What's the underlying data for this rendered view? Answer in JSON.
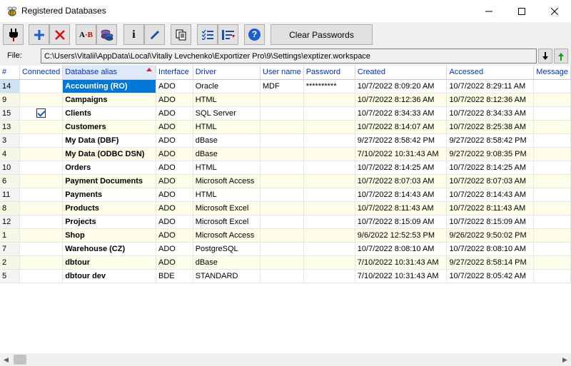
{
  "window": {
    "title": "Registered Databases",
    "minimize_glyph": "—",
    "maximize_glyph": "☐",
    "close_glyph": "✕"
  },
  "toolbar": {
    "buttons": [
      {
        "name": "connect-plug-icon"
      },
      {
        "name": "add-icon"
      },
      {
        "name": "delete-icon"
      },
      {
        "name": "rename-ab-icon",
        "text": "A·B"
      },
      {
        "name": "database-stack-icon"
      },
      {
        "name": "info-icon",
        "text": "i"
      },
      {
        "name": "edit-pen-icon"
      },
      {
        "name": "copy-icon"
      },
      {
        "name": "checklist-icon"
      },
      {
        "name": "sort-list-icon"
      },
      {
        "name": "help-icon",
        "text": "?"
      }
    ],
    "clear_passwords_label": "Clear Passwords"
  },
  "file": {
    "label": "File:",
    "path": "C:\\Users\\Vitalii\\AppData\\Local\\Vitaliy Levchenko\\Exportizer Pro\\9\\Settings\\exptizer.workspace"
  },
  "grid": {
    "columns": [
      "#",
      "Connected",
      "Database alias",
      "Interface",
      "Driver",
      "User name",
      "Password",
      "Created",
      "Accessed",
      "Message"
    ],
    "sorted_column": "Database alias",
    "rows": [
      {
        "num": "14",
        "connected": false,
        "alias": "Accounting (RO)",
        "interface": "ADO",
        "driver": "Oracle",
        "user": "MDF",
        "password": "**********",
        "created": "10/7/2022 8:09:20 AM",
        "accessed": "10/7/2022 8:29:11 AM",
        "selected": true
      },
      {
        "num": "9",
        "connected": false,
        "alias": "Campaigns",
        "interface": "ADO",
        "driver": "HTML",
        "user": "",
        "password": "",
        "created": "10/7/2022 8:12:36 AM",
        "accessed": "10/7/2022 8:12:36 AM"
      },
      {
        "num": "15",
        "connected": true,
        "alias": "Clients",
        "interface": "ADO",
        "driver": "SQL Server",
        "user": "",
        "password": "",
        "created": "10/7/2022 8:34:33 AM",
        "accessed": "10/7/2022 8:34:33 AM"
      },
      {
        "num": "13",
        "connected": false,
        "alias": "Customers",
        "interface": "ADO",
        "driver": "HTML",
        "user": "",
        "password": "",
        "created": "10/7/2022 8:14:07 AM",
        "accessed": "10/7/2022 8:25:38 AM"
      },
      {
        "num": "3",
        "connected": false,
        "alias": "My Data (DBF)",
        "interface": "ADO",
        "driver": "dBase",
        "user": "",
        "password": "",
        "created": "9/27/2022 8:58:42 PM",
        "accessed": "9/27/2022 8:58:42 PM"
      },
      {
        "num": "4",
        "connected": false,
        "alias": "My Data (ODBC DSN)",
        "interface": "ADO",
        "driver": "dBase",
        "user": "",
        "password": "",
        "created": "7/10/2022 10:31:43 AM",
        "accessed": "9/27/2022 9:08:35 PM"
      },
      {
        "num": "10",
        "connected": false,
        "alias": "Orders",
        "interface": "ADO",
        "driver": "HTML",
        "user": "",
        "password": "",
        "created": "10/7/2022 8:14:25 AM",
        "accessed": "10/7/2022 8:14:25 AM"
      },
      {
        "num": "6",
        "connected": false,
        "alias": "Payment Documents",
        "interface": "ADO",
        "driver": "Microsoft Access",
        "user": "",
        "password": "",
        "created": "10/7/2022 8:07:03 AM",
        "accessed": "10/7/2022 8:07:03 AM"
      },
      {
        "num": "11",
        "connected": false,
        "alias": "Payments",
        "interface": "ADO",
        "driver": "HTML",
        "user": "",
        "password": "",
        "created": "10/7/2022 8:14:43 AM",
        "accessed": "10/7/2022 8:14:43 AM"
      },
      {
        "num": "8",
        "connected": false,
        "alias": "Products",
        "interface": "ADO",
        "driver": "Microsoft Excel",
        "user": "",
        "password": "",
        "created": "10/7/2022 8:11:43 AM",
        "accessed": "10/7/2022 8:11:43 AM"
      },
      {
        "num": "12",
        "connected": false,
        "alias": "Projects",
        "interface": "ADO",
        "driver": "Microsoft Excel",
        "user": "",
        "password": "",
        "created": "10/7/2022 8:15:09 AM",
        "accessed": "10/7/2022 8:15:09 AM"
      },
      {
        "num": "1",
        "connected": false,
        "alias": "Shop",
        "interface": "ADO",
        "driver": "Microsoft Access",
        "user": "",
        "password": "",
        "created": "9/6/2022 12:52:53 PM",
        "accessed": "9/26/2022 9:50:02 PM"
      },
      {
        "num": "7",
        "connected": false,
        "alias": "Warehouse (CZ)",
        "interface": "ADO",
        "driver": "PostgreSQL",
        "user": "",
        "password": "",
        "created": "10/7/2022 8:08:10 AM",
        "accessed": "10/7/2022 8:08:10 AM"
      },
      {
        "num": "2",
        "connected": false,
        "alias": "dbtour",
        "interface": "ADO",
        "driver": "dBase",
        "user": "",
        "password": "",
        "created": "7/10/2022 10:31:43 AM",
        "accessed": "9/27/2022 8:58:14 PM"
      },
      {
        "num": "5",
        "connected": false,
        "alias": "dbtour dev",
        "interface": "BDE",
        "driver": "STANDARD",
        "user": "",
        "password": "",
        "created": "7/10/2022 10:31:43 AM",
        "accessed": "10/7/2022 8:05:42 AM"
      }
    ]
  },
  "colors": {
    "header_text": "#0033cc",
    "selection": "#0078d7",
    "alt_row": "#fdfde8",
    "sort_arrow": "#e02020"
  }
}
